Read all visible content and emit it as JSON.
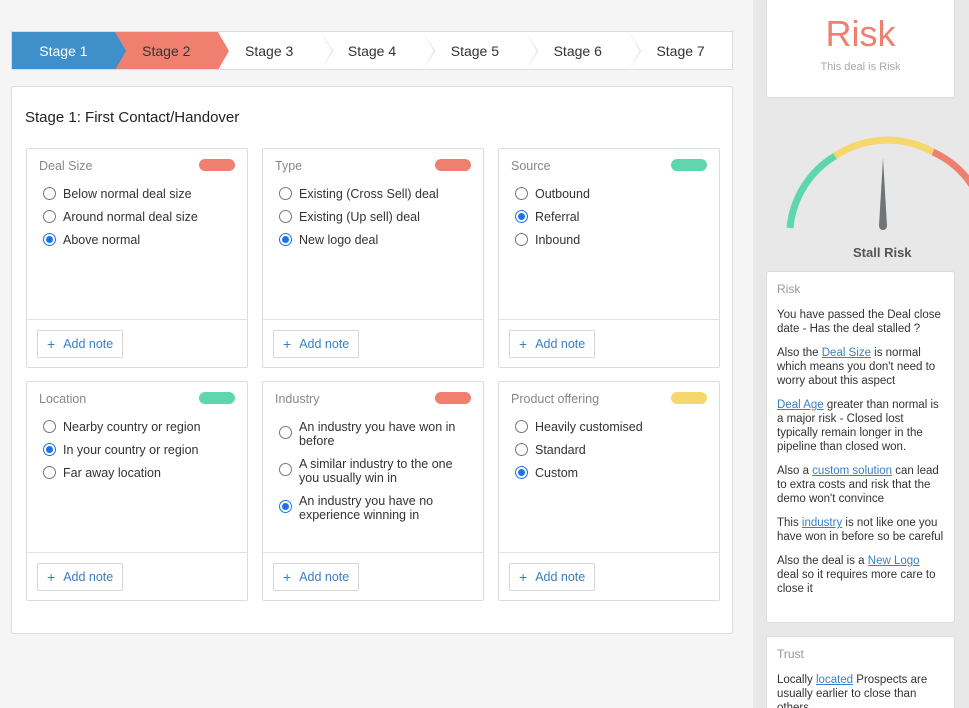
{
  "stages": [
    "Stage 1",
    "Stage 2",
    "Stage 3",
    "Stage 4",
    "Stage 5",
    "Stage 6",
    "Stage 7"
  ],
  "main_title": "Stage 1: First Contact/Handover",
  "add_note_label": "Add note",
  "cards": [
    {
      "title": "Deal Size",
      "pill_color": "#ef8070",
      "options": [
        "Below normal deal size",
        "Around normal deal size",
        "Above normal"
      ],
      "selected": 2
    },
    {
      "title": "Type",
      "pill_color": "#ef8070",
      "options": [
        "Existing (Cross Sell) deal",
        "Existing (Up sell) deal",
        "New logo deal"
      ],
      "selected": 2
    },
    {
      "title": "Source",
      "pill_color": "#5fd6ab",
      "options": [
        "Outbound",
        "Referral",
        "Inbound"
      ],
      "selected": 1
    },
    {
      "title": "Location",
      "pill_color": "#5fd6ab",
      "options": [
        "Nearby country or region",
        "In your country or region",
        "Far away location"
      ],
      "selected": 1
    },
    {
      "title": "Industry",
      "pill_color": "#ef8070",
      "options": [
        "An industry you have won in before",
        "A similar industry to the one you usually win in",
        "An industry you have no experience winning in"
      ],
      "selected": 2
    },
    {
      "title": "Product offering",
      "pill_color": "#f5d76e",
      "options": [
        "Heavily customised",
        "Standard",
        "Custom"
      ],
      "selected": 2
    }
  ],
  "risk": {
    "title": "Risk",
    "subtitle": "This deal is Risk"
  },
  "gauge_label": "Stall Risk",
  "risk_panel": {
    "heading": "Risk",
    "p1": "You have passed the Deal close date - Has the deal stalled ?",
    "p2_pre": "Also the ",
    "p2_link": "Deal Size",
    "p2_post": " is normal which means you don't need to worry about this aspect",
    "p3_link": "Deal Age",
    "p3_post": " greater than normal is a major risk - Closed lost typically remain longer in the pipeline than closed won.",
    "p4_pre": "Also a ",
    "p4_link": "custom solution",
    "p4_post": " can lead to extra costs and risk that the demo won't convince",
    "p5_pre": "This ",
    "p5_link": "industry",
    "p5_post": " is not like one you have won in before so be careful",
    "p6_pre": "Also the deal is a ",
    "p6_link": "New Logo",
    "p6_post": " deal so it requires more care to close it"
  },
  "trust_panel": {
    "heading": "Trust",
    "p1_pre": "Locally ",
    "p1_link": "located",
    "p1_post": " Prospects are usually earlier to close than others"
  },
  "colors": {
    "stage_active": "#3f8fcb",
    "stage_done": "#ef8070",
    "gauge_green": "#5fd6ab",
    "gauge_yellow": "#f5d76e",
    "gauge_red": "#ef8070"
  }
}
